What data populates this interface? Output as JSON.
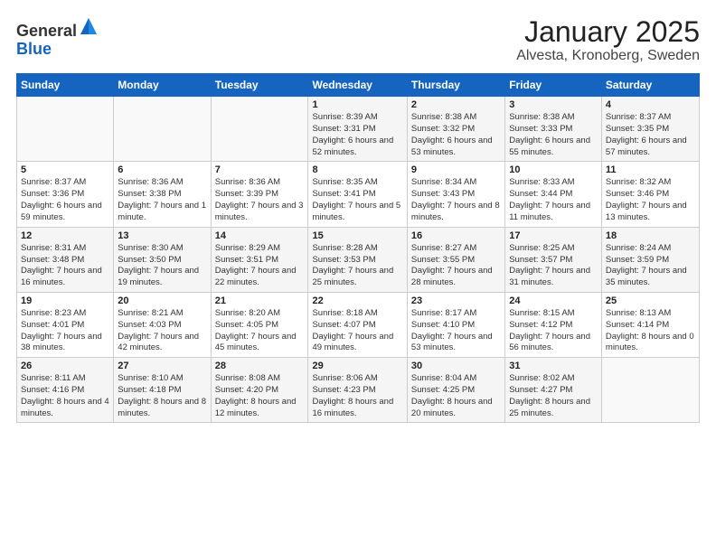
{
  "header": {
    "logo_general": "General",
    "logo_blue": "Blue",
    "title": "January 2025",
    "subtitle": "Alvesta, Kronoberg, Sweden"
  },
  "days_of_week": [
    "Sunday",
    "Monday",
    "Tuesday",
    "Wednesday",
    "Thursday",
    "Friday",
    "Saturday"
  ],
  "weeks": [
    [
      {
        "day": "",
        "info": ""
      },
      {
        "day": "",
        "info": ""
      },
      {
        "day": "",
        "info": ""
      },
      {
        "day": "1",
        "info": "Sunrise: 8:39 AM\nSunset: 3:31 PM\nDaylight: 6 hours and 52 minutes."
      },
      {
        "day": "2",
        "info": "Sunrise: 8:38 AM\nSunset: 3:32 PM\nDaylight: 6 hours and 53 minutes."
      },
      {
        "day": "3",
        "info": "Sunrise: 8:38 AM\nSunset: 3:33 PM\nDaylight: 6 hours and 55 minutes."
      },
      {
        "day": "4",
        "info": "Sunrise: 8:37 AM\nSunset: 3:35 PM\nDaylight: 6 hours and 57 minutes."
      }
    ],
    [
      {
        "day": "5",
        "info": "Sunrise: 8:37 AM\nSunset: 3:36 PM\nDaylight: 6 hours and 59 minutes."
      },
      {
        "day": "6",
        "info": "Sunrise: 8:36 AM\nSunset: 3:38 PM\nDaylight: 7 hours and 1 minute."
      },
      {
        "day": "7",
        "info": "Sunrise: 8:36 AM\nSunset: 3:39 PM\nDaylight: 7 hours and 3 minutes."
      },
      {
        "day": "8",
        "info": "Sunrise: 8:35 AM\nSunset: 3:41 PM\nDaylight: 7 hours and 5 minutes."
      },
      {
        "day": "9",
        "info": "Sunrise: 8:34 AM\nSunset: 3:43 PM\nDaylight: 7 hours and 8 minutes."
      },
      {
        "day": "10",
        "info": "Sunrise: 8:33 AM\nSunset: 3:44 PM\nDaylight: 7 hours and 11 minutes."
      },
      {
        "day": "11",
        "info": "Sunrise: 8:32 AM\nSunset: 3:46 PM\nDaylight: 7 hours and 13 minutes."
      }
    ],
    [
      {
        "day": "12",
        "info": "Sunrise: 8:31 AM\nSunset: 3:48 PM\nDaylight: 7 hours and 16 minutes."
      },
      {
        "day": "13",
        "info": "Sunrise: 8:30 AM\nSunset: 3:50 PM\nDaylight: 7 hours and 19 minutes."
      },
      {
        "day": "14",
        "info": "Sunrise: 8:29 AM\nSunset: 3:51 PM\nDaylight: 7 hours and 22 minutes."
      },
      {
        "day": "15",
        "info": "Sunrise: 8:28 AM\nSunset: 3:53 PM\nDaylight: 7 hours and 25 minutes."
      },
      {
        "day": "16",
        "info": "Sunrise: 8:27 AM\nSunset: 3:55 PM\nDaylight: 7 hours and 28 minutes."
      },
      {
        "day": "17",
        "info": "Sunrise: 8:25 AM\nSunset: 3:57 PM\nDaylight: 7 hours and 31 minutes."
      },
      {
        "day": "18",
        "info": "Sunrise: 8:24 AM\nSunset: 3:59 PM\nDaylight: 7 hours and 35 minutes."
      }
    ],
    [
      {
        "day": "19",
        "info": "Sunrise: 8:23 AM\nSunset: 4:01 PM\nDaylight: 7 hours and 38 minutes."
      },
      {
        "day": "20",
        "info": "Sunrise: 8:21 AM\nSunset: 4:03 PM\nDaylight: 7 hours and 42 minutes."
      },
      {
        "day": "21",
        "info": "Sunrise: 8:20 AM\nSunset: 4:05 PM\nDaylight: 7 hours and 45 minutes."
      },
      {
        "day": "22",
        "info": "Sunrise: 8:18 AM\nSunset: 4:07 PM\nDaylight: 7 hours and 49 minutes."
      },
      {
        "day": "23",
        "info": "Sunrise: 8:17 AM\nSunset: 4:10 PM\nDaylight: 7 hours and 53 minutes."
      },
      {
        "day": "24",
        "info": "Sunrise: 8:15 AM\nSunset: 4:12 PM\nDaylight: 7 hours and 56 minutes."
      },
      {
        "day": "25",
        "info": "Sunrise: 8:13 AM\nSunset: 4:14 PM\nDaylight: 8 hours and 0 minutes."
      }
    ],
    [
      {
        "day": "26",
        "info": "Sunrise: 8:11 AM\nSunset: 4:16 PM\nDaylight: 8 hours and 4 minutes."
      },
      {
        "day": "27",
        "info": "Sunrise: 8:10 AM\nSunset: 4:18 PM\nDaylight: 8 hours and 8 minutes."
      },
      {
        "day": "28",
        "info": "Sunrise: 8:08 AM\nSunset: 4:20 PM\nDaylight: 8 hours and 12 minutes."
      },
      {
        "day": "29",
        "info": "Sunrise: 8:06 AM\nSunset: 4:23 PM\nDaylight: 8 hours and 16 minutes."
      },
      {
        "day": "30",
        "info": "Sunrise: 8:04 AM\nSunset: 4:25 PM\nDaylight: 8 hours and 20 minutes."
      },
      {
        "day": "31",
        "info": "Sunrise: 8:02 AM\nSunset: 4:27 PM\nDaylight: 8 hours and 25 minutes."
      },
      {
        "day": "",
        "info": ""
      }
    ]
  ]
}
